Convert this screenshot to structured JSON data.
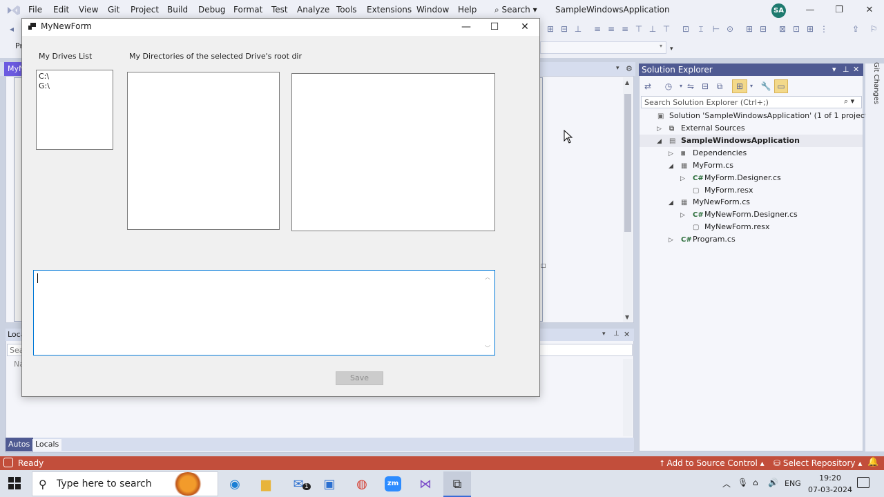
{
  "vs": {
    "menu": [
      "File",
      "Edit",
      "View",
      "Git",
      "Project",
      "Build",
      "Debug",
      "Format",
      "Test",
      "Analyze",
      "Tools",
      "Extensions",
      "Window",
      "Help"
    ],
    "search_label": "Search",
    "solution_name": "SampleWindowsApplication",
    "avatar_initials": "SA",
    "doc_tab_label": "MyN",
    "toolbar_left_label": "Pr"
  },
  "form": {
    "title": "MyNewForm",
    "drives_label": "My Drives List",
    "dirs_label": "My Directories of the selected Drive's root dir",
    "drives": [
      "C:\\",
      "G:\\"
    ],
    "save_label": "Save",
    "save_enabled": false
  },
  "locals": {
    "title": "Loca",
    "search_placeholder": "Sea",
    "column_name": "Na",
    "tab_autos": "Autos",
    "tab_locals": "Locals"
  },
  "solution_explorer": {
    "title": "Solution Explorer",
    "search_placeholder": "Search Solution Explorer (Ctrl+;)",
    "tree": [
      {
        "label": "Solution 'SampleWindowsApplication' (1 of 1 project)",
        "icon": "solution-icon",
        "expander": ""
      },
      {
        "label": "External Sources",
        "icon": "external-sources-icon",
        "expander": "▷"
      },
      {
        "label": "SampleWindowsApplication",
        "icon": "csharp-project-icon",
        "expander": "◢",
        "bold": true,
        "selected": true
      },
      {
        "label": "Dependencies",
        "icon": "dependencies-icon",
        "expander": "▷"
      },
      {
        "label": "MyForm.cs",
        "icon": "form-icon",
        "expander": "◢"
      },
      {
        "label": "MyForm.Designer.cs",
        "icon": "csharp-file-icon",
        "expander": "▷"
      },
      {
        "label": "MyForm.resx",
        "icon": "resx-icon",
        "expander": ""
      },
      {
        "label": "MyNewForm.cs",
        "icon": "form-icon",
        "expander": "◢"
      },
      {
        "label": "MyNewForm.Designer.cs",
        "icon": "csharp-file-icon",
        "expander": "▷"
      },
      {
        "label": "MyNewForm.resx",
        "icon": "resx-icon",
        "expander": ""
      },
      {
        "label": "Program.cs",
        "icon": "csharp-file-icon",
        "expander": "▷"
      }
    ],
    "git_changes_label": "Git Changes"
  },
  "status": {
    "ready": "Ready",
    "add_to_source": "Add to Source Control",
    "select_repo": "Select Repository",
    "bar_color": "#c24e3b"
  },
  "taskbar": {
    "search_placeholder": "Type here to search",
    "language": "ENG",
    "time": "19:20",
    "date": "07-03-2024",
    "mail_badge": "1",
    "zoom_label": "zm"
  },
  "colors": {
    "accent": "#4f5a92",
    "selection": "#0078d7"
  }
}
